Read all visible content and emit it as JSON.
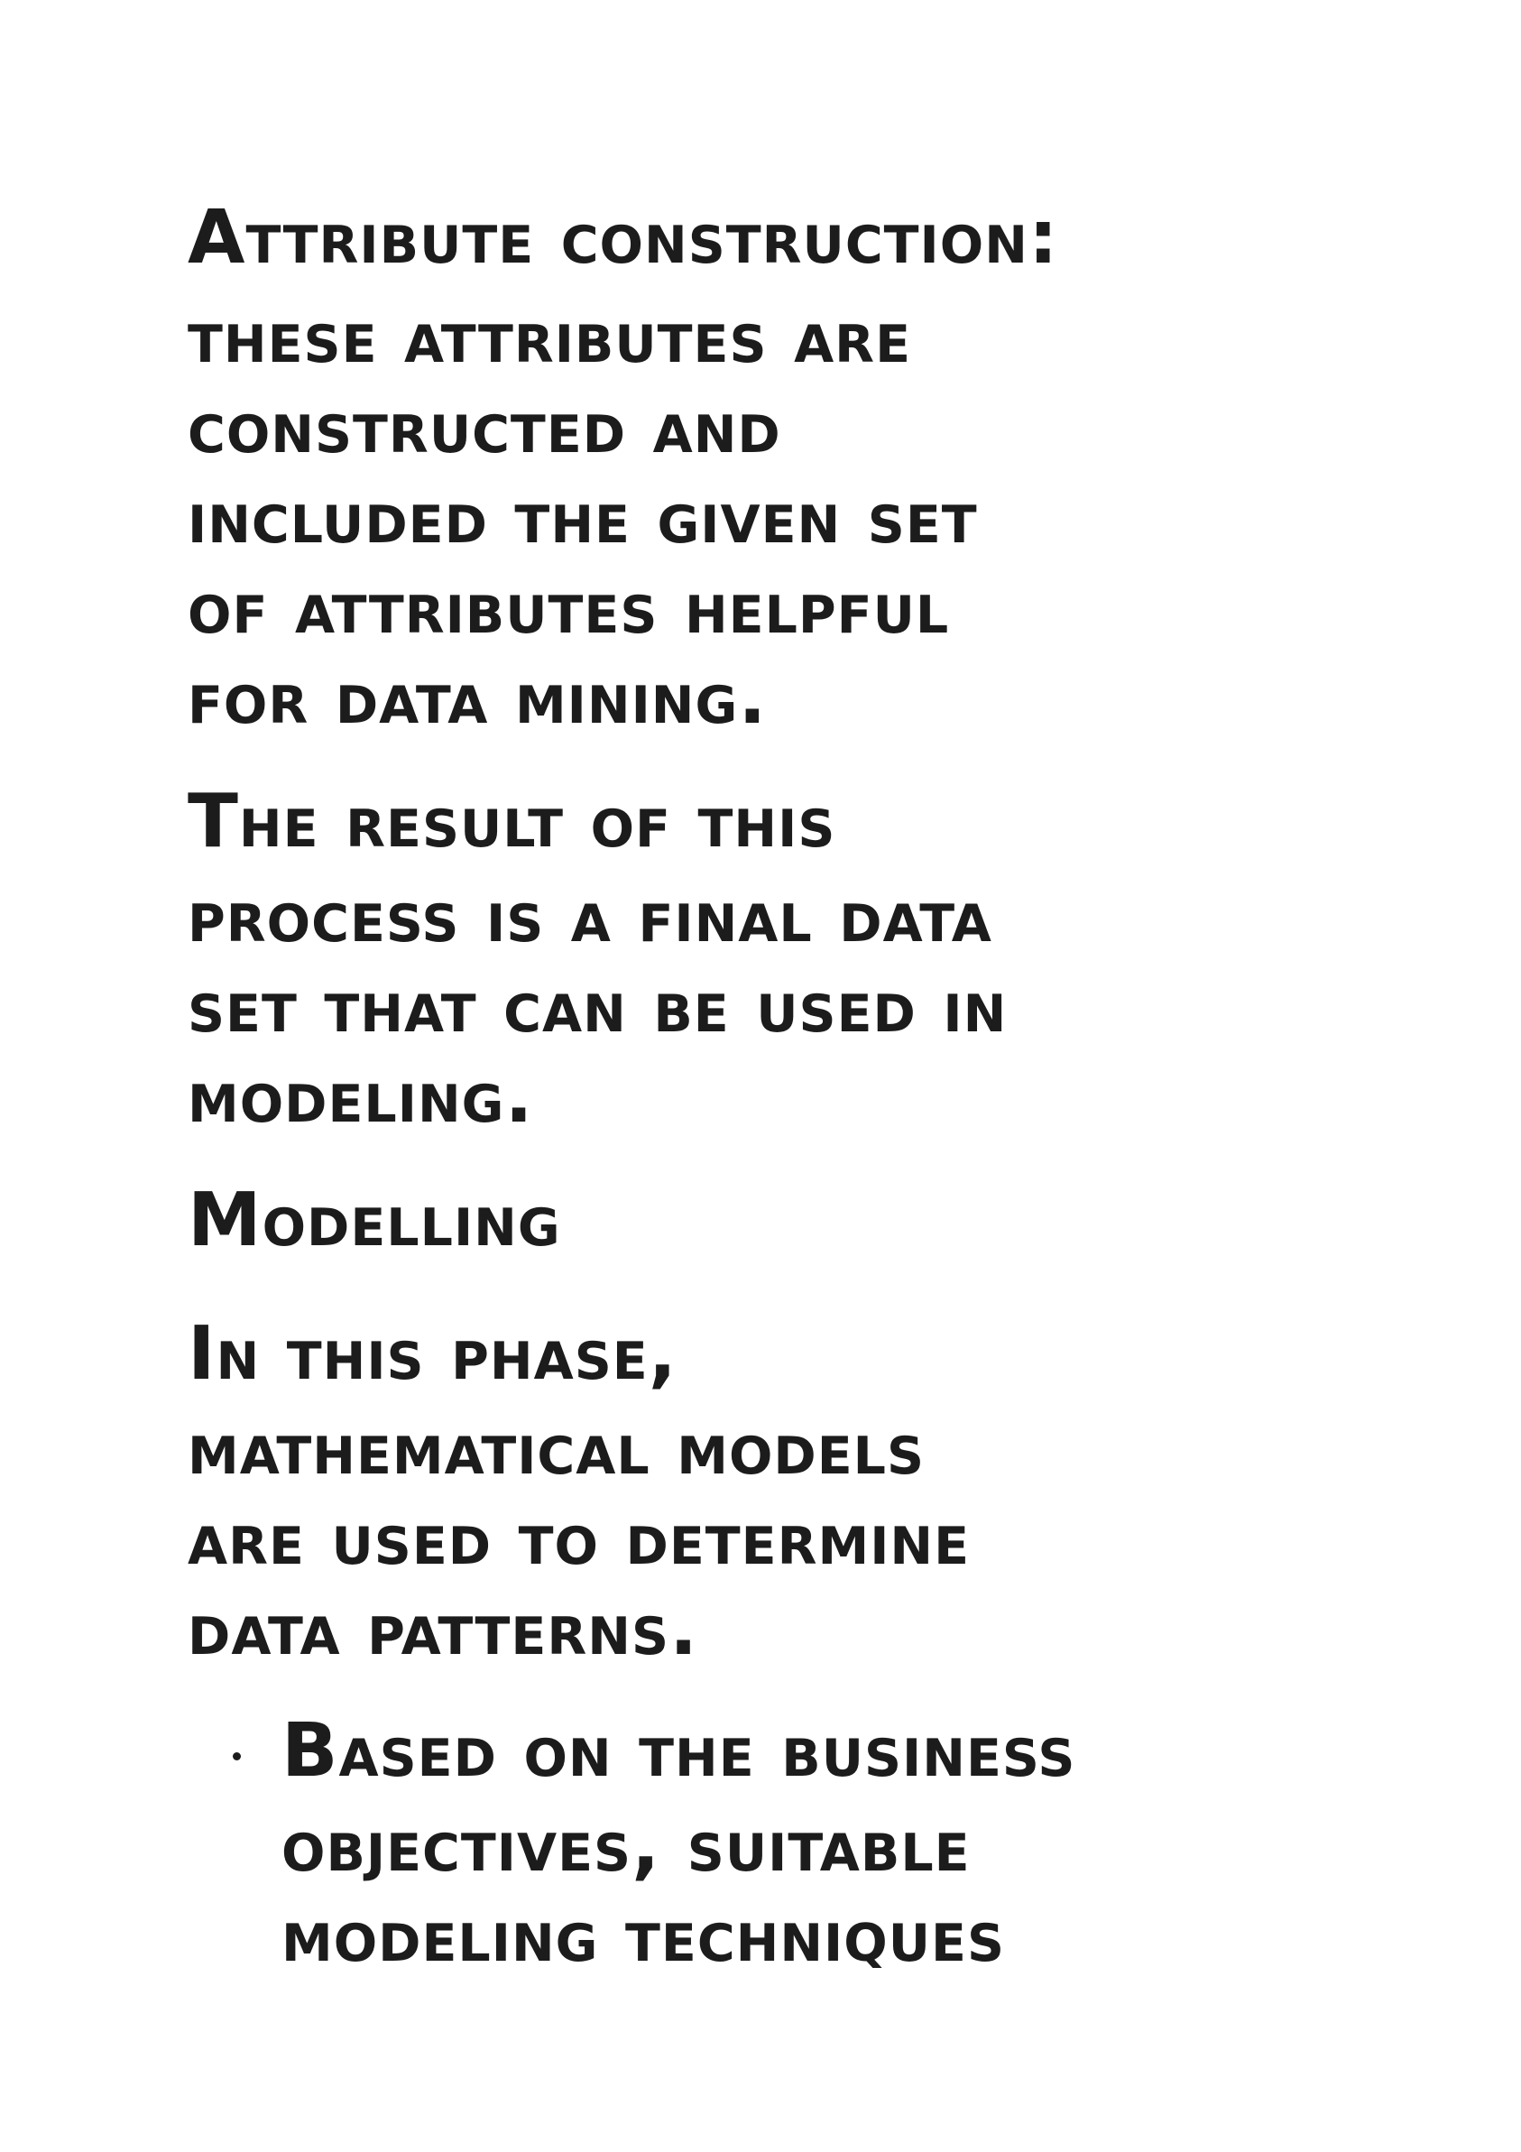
{
  "blocks": [
    {
      "id": "attribute-construction",
      "lines": [
        "Attribute construction:",
        "these attributes are",
        "constructed and",
        "included the given set",
        "of attributes helpful",
        "for data mining."
      ]
    },
    {
      "id": "result",
      "lines": [
        "The result of this",
        "process is a final data",
        "set that can be used in",
        "modeling."
      ]
    },
    {
      "id": "modelling-heading",
      "lines": [
        "Modelling"
      ]
    },
    {
      "id": "phase",
      "lines": [
        "In this phase,",
        "mathematical models",
        "are used to determine",
        "data patterns."
      ]
    },
    {
      "id": "bullet-item",
      "lines": [
        "Based on the business",
        "objectives, suitable",
        "modeling techniques"
      ]
    }
  ]
}
